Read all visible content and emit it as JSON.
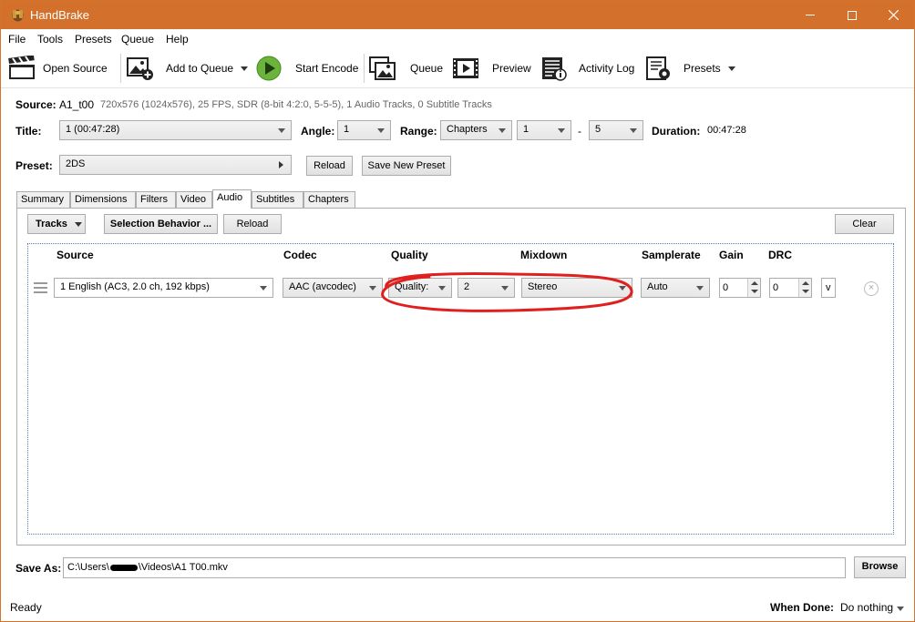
{
  "window": {
    "title": "HandBrake"
  },
  "menu": [
    "File",
    "Tools",
    "Presets",
    "Queue",
    "Help"
  ],
  "toolbar": {
    "open_source": "Open Source",
    "add_to_queue": "Add to Queue",
    "start_encode": "Start Encode",
    "queue": "Queue",
    "preview": "Preview",
    "activity_log": "Activity Log",
    "presets": "Presets"
  },
  "source": {
    "label": "Source:",
    "name": "A1_t00",
    "info": "720x576 (1024x576), 25 FPS, SDR (8-bit 4:2:0, 5-5-5), 1 Audio Tracks, 0 Subtitle Tracks"
  },
  "title_row": {
    "title_label": "Title:",
    "title_value": "1  (00:47:28)",
    "angle_label": "Angle:",
    "angle_value": "1",
    "range_label": "Range:",
    "range_type": "Chapters",
    "range_start": "1",
    "range_sep": "-",
    "range_end": "5",
    "duration_label": "Duration:",
    "duration_value": "00:47:28"
  },
  "preset_row": {
    "label": "Preset:",
    "value": "2DS",
    "reload": "Reload",
    "save_new": "Save New Preset"
  },
  "tabs": [
    "Summary",
    "Dimensions",
    "Filters",
    "Video",
    "Audio",
    "Subtitles",
    "Chapters"
  ],
  "active_tab": "Audio",
  "audio": {
    "tracks_btn": "Tracks",
    "selection_behavior_btn": "Selection Behavior ...",
    "reload_btn": "Reload",
    "clear_btn": "Clear",
    "columns": {
      "source": "Source",
      "codec": "Codec",
      "quality": "Quality",
      "mixdown": "Mixdown",
      "samplerate": "Samplerate",
      "gain": "Gain",
      "drc": "DRC"
    },
    "track": {
      "source": "1 English (AC3, 2.0 ch, 192 kbps)",
      "codec": "AAC (avcodec)",
      "quality_mode": "Quality:",
      "quality_value": "2",
      "mixdown": "Stereo",
      "samplerate": "Auto",
      "gain": "0",
      "drc": "0",
      "more": "v"
    }
  },
  "save_as": {
    "label": "Save As:",
    "path_prefix": "C:\\Users\\",
    "path_suffix": "\\Videos\\A1 T00.mkv",
    "browse": "Browse"
  },
  "status": {
    "text": "Ready",
    "when_done_label": "When Done:",
    "when_done_value": "Do nothing"
  },
  "colors": {
    "titlebar": "#d3712c",
    "annotation": "#e0201e"
  },
  "icons": [
    "handbrake-logo-icon",
    "clapperboard-icon",
    "add-image-icon",
    "play-icon",
    "queue-images-icon",
    "film-preview-icon",
    "activity-log-icon",
    "presets-settings-icon",
    "remove-track-icon"
  ]
}
